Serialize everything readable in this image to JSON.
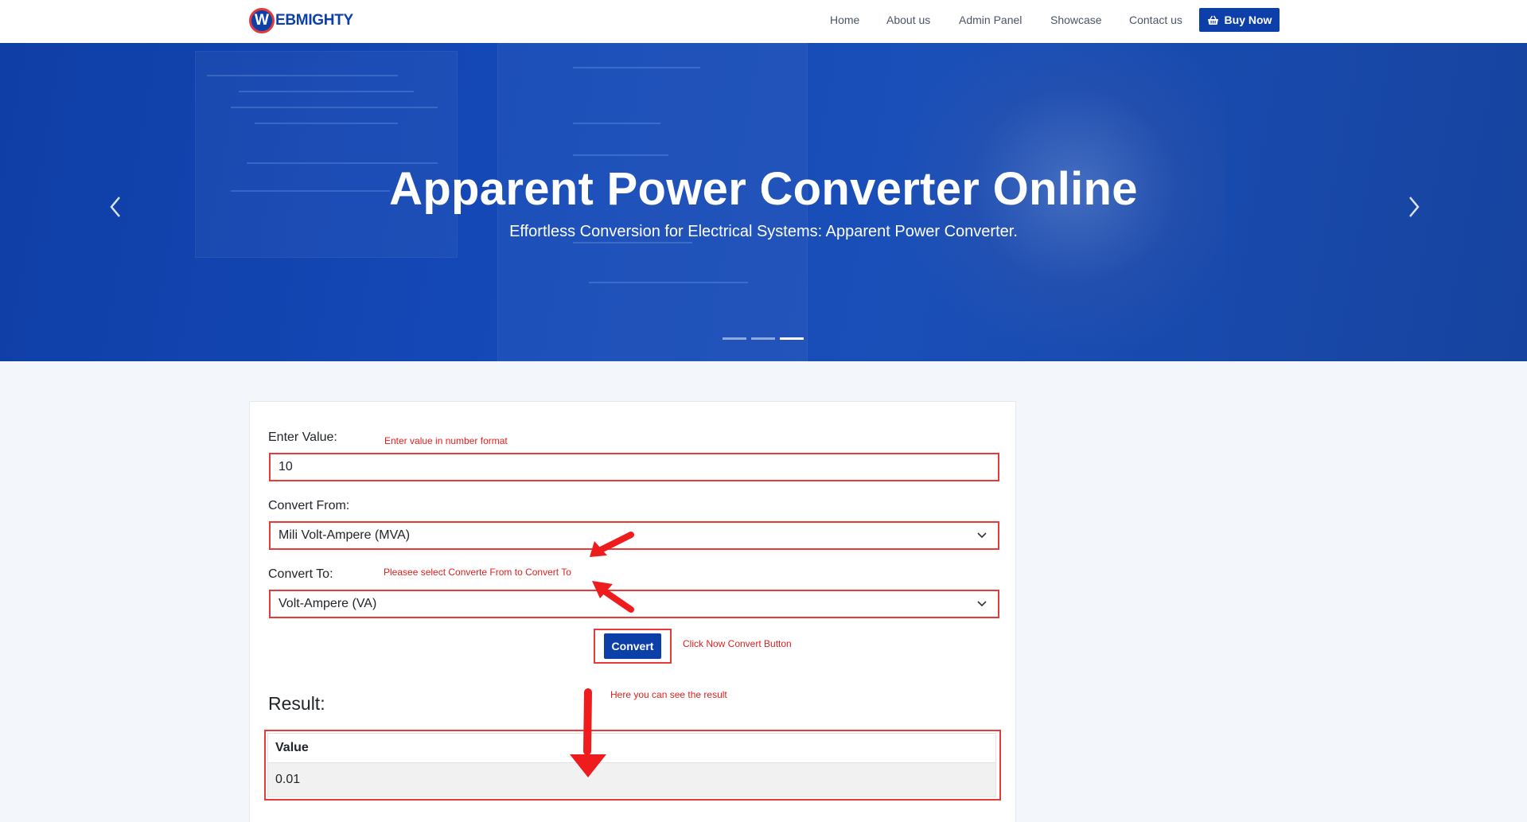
{
  "header": {
    "logo_letter": "W",
    "logo_text": "EBMIGHTY",
    "nav": [
      "Home",
      "About us",
      "Admin Panel",
      "Showcase",
      "Contact us"
    ],
    "buy_label": "Buy Now"
  },
  "hero": {
    "title": "Apparent Power Converter Online",
    "subtitle": "Effortless Conversion for Electrical Systems: Apparent Power Converter.",
    "slides": 3,
    "active_slide": 3
  },
  "form": {
    "value_label": "Enter Value:",
    "value_hint": "Enter value  in number format",
    "value": "10",
    "from_label": "Convert From:",
    "from_value": "Mili Volt-Ampere (MVA)",
    "select_hint": "Pleasee select Converte From to Convert To",
    "to_label": "Convert To:",
    "to_value": "Volt-Ampere (VA)",
    "convert_label": "Convert",
    "convert_hint": "Click Now Convert Button"
  },
  "result": {
    "title": "Result:",
    "hint": "Here you can see the result",
    "column": "Value",
    "value": "0.01"
  },
  "colors": {
    "brand": "#0d3fa8",
    "annotation": "#e01f1f"
  }
}
